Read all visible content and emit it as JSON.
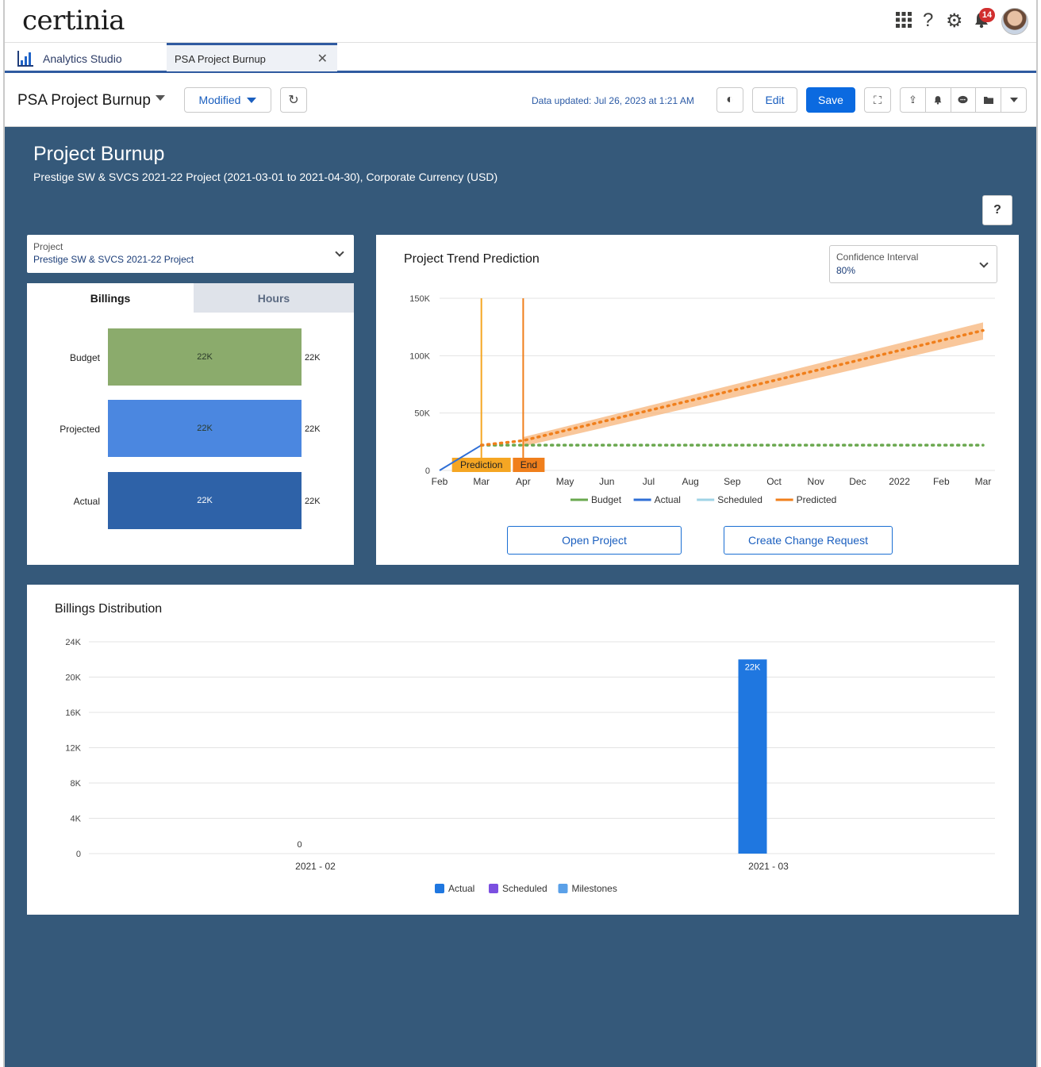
{
  "brand": {
    "logo_text": "certinia",
    "notification_count": "14"
  },
  "top_icons": {
    "app_launcher": "grid-icon",
    "help": "question-icon",
    "setup": "gear-icon",
    "notifications": "bell-icon"
  },
  "tabs": {
    "app_name": "Analytics Studio",
    "page_tab": "PSA Project Burnup",
    "close": "✕"
  },
  "toolbar": {
    "dashboard_title": "PSA Project Burnup",
    "modified_label": "Modified",
    "data_updated": "Data updated: Jul 26, 2023 at 1:21 AM",
    "edit_label": "Edit",
    "save_label": "Save",
    "accent_color": "#0b6ae0"
  },
  "header": {
    "title": "Project Burnup",
    "subtitle": "Prestige SW & SVCS 2021-22 Project (2021-03-01 to 2021-04-30), Corporate Currency (USD)",
    "help_label": "?"
  },
  "project_filter": {
    "label": "Project",
    "value": "Prestige SW & SVCS 2021-22 Project"
  },
  "billings_panel": {
    "tabs": [
      "Billings",
      "Hours"
    ],
    "active_tab": "Billings",
    "bars": [
      {
        "label": "Budget",
        "value_label": "22K",
        "end_label": "22K",
        "value": 22000,
        "color": "#8bab6c"
      },
      {
        "label": "Projected",
        "value_label": "22K",
        "end_label": "22K",
        "value": 22000,
        "color": "#4b87e0"
      },
      {
        "label": "Actual",
        "value_label": "22K",
        "end_label": "22K",
        "value": 22000,
        "color": "#2e62a8"
      }
    ]
  },
  "trend_panel": {
    "title": "Project Trend Prediction",
    "confidence": {
      "label": "Confidence Interval",
      "value": "80%"
    },
    "open_project_label": "Open Project",
    "change_request_label": "Create Change Request",
    "markers": [
      {
        "label": "Prediction",
        "x": "Mar"
      },
      {
        "label": "End",
        "x": "Apr"
      }
    ]
  },
  "distribution_panel": {
    "title": "Billings Distribution"
  },
  "chart_data": [
    {
      "type": "line",
      "title": "Project Trend Prediction",
      "x": [
        "Feb",
        "Mar",
        "Apr",
        "May",
        "Jun",
        "Jul",
        "Aug",
        "Sep",
        "Oct",
        "Nov",
        "Dec",
        "2022",
        "Feb",
        "Mar"
      ],
      "ylim": [
        0,
        150000
      ],
      "yticks": [
        0,
        50000,
        100000,
        150000
      ],
      "ytick_labels": [
        "0",
        "50K",
        "100K",
        "150K"
      ],
      "series": [
        {
          "name": "Budget",
          "color": "#6aa84f",
          "style": "dotted",
          "points": [
            [
              1,
              22000
            ],
            [
              13,
              22000
            ]
          ]
        },
        {
          "name": "Actual",
          "color": "#2f6fd6",
          "style": "solid",
          "points": [
            [
              0,
              0
            ],
            [
              1,
              22000
            ]
          ]
        },
        {
          "name": "Scheduled",
          "color": "#9fd3e6",
          "style": "solid",
          "points": []
        },
        {
          "name": "Predicted",
          "color": "#f07f1c",
          "style": "dotted",
          "points": [
            [
              1,
              22000
            ],
            [
              2,
              26000
            ],
            [
              13,
              122000
            ]
          ]
        }
      ],
      "confidence_band": {
        "color": "#f7b47a",
        "lower": [
          [
            2,
            21000
          ],
          [
            13,
            114000
          ]
        ],
        "upper": [
          [
            2,
            29000
          ],
          [
            13,
            129000
          ]
        ]
      },
      "legend": [
        "Budget",
        "Actual",
        "Scheduled",
        "Predicted"
      ],
      "legend_position": "bottom",
      "grid": true
    },
    {
      "type": "bar",
      "title": "Billings Distribution",
      "categories": [
        "2021 - 02",
        "2021 - 03"
      ],
      "series": [
        {
          "name": "Actual",
          "color": "#1f77e0",
          "values": [
            0,
            22000
          ],
          "labels": [
            "0",
            "22K"
          ]
        },
        {
          "name": "Scheduled",
          "color": "#7b4fe0",
          "values": [
            0,
            0
          ]
        },
        {
          "name": "Milestones",
          "color": "#5aa0e8",
          "values": [
            0,
            0
          ]
        }
      ],
      "ylim": [
        0,
        24000
      ],
      "yticks": [
        0,
        4000,
        8000,
        12000,
        16000,
        20000,
        24000
      ],
      "ytick_labels": [
        "0",
        "4K",
        "8K",
        "12K",
        "16K",
        "20K",
        "24K"
      ],
      "legend": [
        "Actual",
        "Scheduled",
        "Milestones"
      ],
      "legend_position": "bottom",
      "grid": true
    }
  ]
}
